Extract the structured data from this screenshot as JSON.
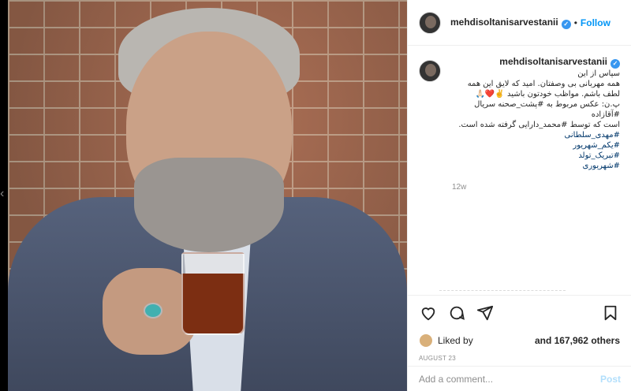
{
  "post": {
    "username": "mehdisoltanisarvestanii",
    "verified_mark": "✓",
    "follow_label": "Follow",
    "dot": "•"
  },
  "caption": {
    "username": "mehdisoltanisarvestanii",
    "lines": [
      "سپاس از این",
      "همه مهربانی بی وصفتان. امید که لایق این همه",
      "لطف باشم. مواظب خودتون باشید ✌️❤️🙏🏻",
      "پ.ن: عکس مربوط به #پشت_صحنه سریال #آقازاده",
      "است که توسط #محمد_دارایی گرفته شده است."
    ],
    "hashtags": [
      "#مهدی_سلطانی",
      "#یکم_شهریور",
      "#تبریک_تولد",
      "#شهریوری"
    ],
    "age": "12w"
  },
  "likes": {
    "liked_by_label": "Liked by",
    "others_label": "and 167,962 others"
  },
  "date": "AUGUST 23",
  "comment": {
    "placeholder": "Add a comment...",
    "post_label": "Post"
  },
  "icons": {
    "like": "heart-icon",
    "comment": "comment-icon",
    "share": "share-icon",
    "save": "bookmark-icon"
  },
  "colors": {
    "link": "#0095f6",
    "verified": "#3897f0",
    "post_disabled": "#b2dffc"
  }
}
